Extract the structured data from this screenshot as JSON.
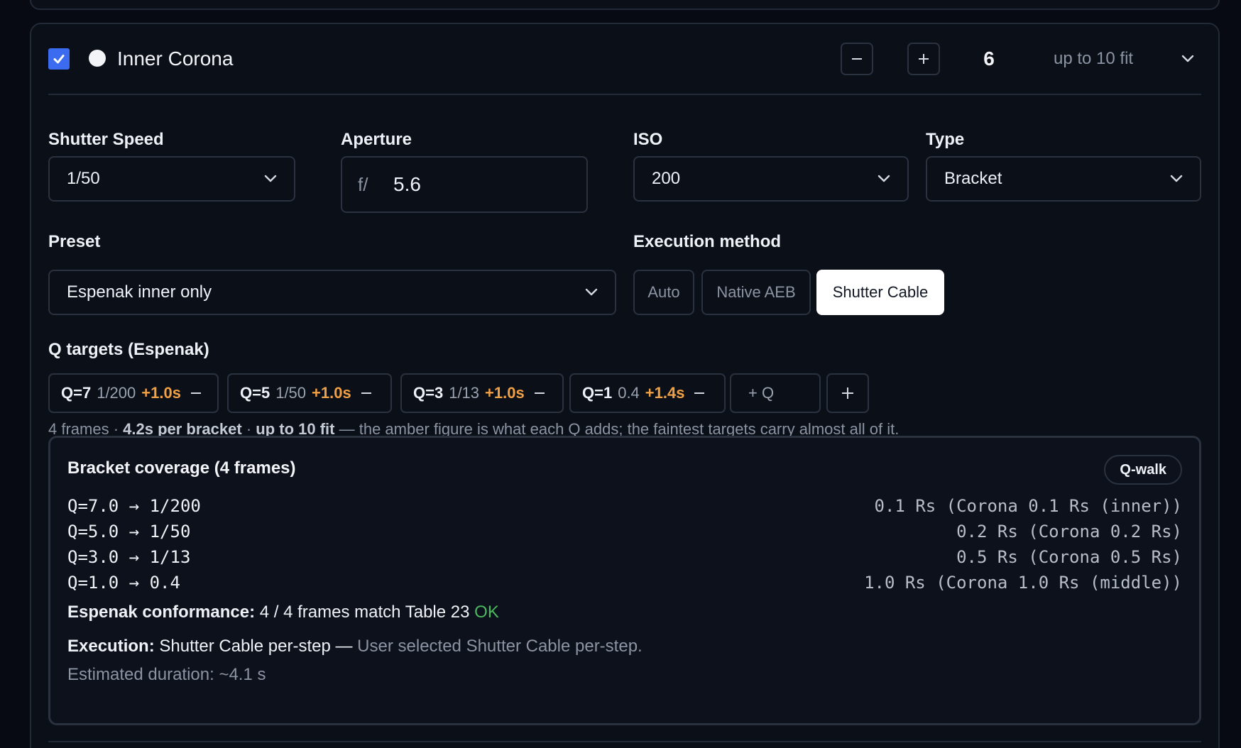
{
  "card": {
    "title": "Inner Corona",
    "enabled": true,
    "count": "6",
    "fit_label": "up to 10 fit",
    "accent": "#3b6cf0"
  },
  "fields": {
    "shutter": {
      "label": "Shutter Speed",
      "value": "1/50"
    },
    "aperture": {
      "label": "Aperture",
      "prefix": "f/",
      "value": "5.6"
    },
    "iso": {
      "label": "ISO",
      "value": "200"
    },
    "type": {
      "label": "Type",
      "value": "Bracket"
    },
    "preset": {
      "label": "Preset",
      "value": "Espenak inner only"
    },
    "execution": {
      "label": "Execution method",
      "options": [
        "Auto",
        "Native AEB",
        "Shutter Cable"
      ],
      "selected": "Shutter Cable"
    }
  },
  "q_targets": {
    "label": "Q targets (Espenak)",
    "chips": [
      {
        "q": "Q=7",
        "speed": "1/200",
        "add": "+1.0s"
      },
      {
        "q": "Q=5",
        "speed": "1/50",
        "add": "+1.0s"
      },
      {
        "q": "Q=3",
        "speed": "1/13",
        "add": "+1.0s"
      },
      {
        "q": "Q=1",
        "speed": "0.4",
        "add": "+1.4s"
      }
    ],
    "add_q_label": "+ Q",
    "amber": "#f0a146",
    "summary": {
      "frames": "4 frames",
      "per_bracket": "4.2s per bracket",
      "fit": "up to 10 fit",
      "note": "— the amber figure is what each Q adds; the faintest targets carry almost all of it."
    }
  },
  "coverage": {
    "title": "Bracket coverage (4 frames)",
    "badge": "Q-walk",
    "rows": [
      {
        "left": "Q=7.0 → 1/200",
        "right": "0.1 Rs (Corona 0.1 Rs (inner))"
      },
      {
        "left": "Q=5.0 → 1/50",
        "right": "0.2 Rs (Corona 0.2 Rs)"
      },
      {
        "left": "Q=3.0 → 1/13",
        "right": "0.5 Rs (Corona 0.5 Rs)"
      },
      {
        "left": "Q=1.0 → 0.4",
        "right": "1.0 Rs (Corona 1.0 Rs (middle))"
      }
    ],
    "conformance_label": "Espenak conformance:",
    "conformance_text": "4 / 4 frames match Table 23",
    "conformance_status": "OK",
    "execution_label": "Execution:",
    "execution_text": "Shutter Cable per-step —",
    "execution_note": "User selected Shutter Cable per-step.",
    "duration": "Estimated duration: ~4.1 s"
  }
}
